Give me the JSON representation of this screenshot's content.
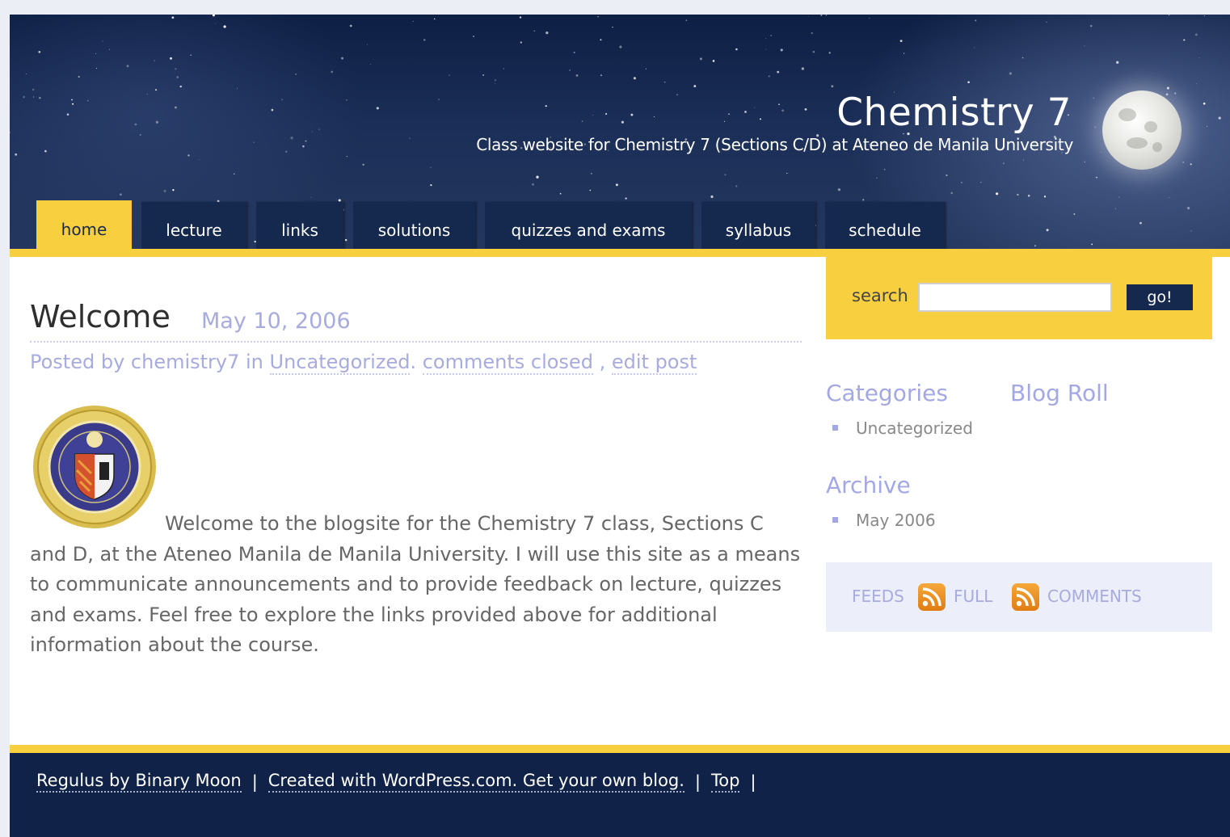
{
  "header": {
    "site_title": "Chemistry 7",
    "tagline": "Class website for Chemistry 7 (Sections C/D) at Ateneo de Manila University"
  },
  "nav": {
    "tabs": [
      {
        "label": "home",
        "active": true
      },
      {
        "label": "lecture"
      },
      {
        "label": "links"
      },
      {
        "label": "solutions"
      },
      {
        "label": "quizzes and exams"
      },
      {
        "label": "syllabus"
      },
      {
        "label": "schedule"
      }
    ]
  },
  "post": {
    "title": "Welcome",
    "date": "May 10, 2006",
    "meta_prefix": "Posted by chemistry7 in",
    "category": "Uncategorized",
    "comments": "comments closed",
    "meta_sep": ",",
    "edit": "edit post",
    "body": "Welcome to the blogsite for the Chemistry 7 class, Sections C and D, at the Ateneo Manila de Manila University. I will use this site as a means to communicate announcements and to provide feedback on lecture, quizzes and exams. Feel free to explore the links provided above for additional information about the course."
  },
  "sidebar": {
    "search_label": "search",
    "search_value": "",
    "search_button": "go!",
    "categories_title": "Categories",
    "categories": [
      "Uncategorized"
    ],
    "blogroll_title": "Blog Roll",
    "archive_title": "Archive",
    "archive": [
      "May 2006"
    ],
    "feeds_label": "FEEDS",
    "feed_full": "FULL",
    "feed_comments": "COMMENTS"
  },
  "footer": {
    "theme_link": "Regulus by Binary Moon",
    "wp_link": "Created with WordPress.com. Get your own blog.",
    "top_link": "Top",
    "separator": "|"
  },
  "colors": {
    "header_navy": "#15294f",
    "accent_yellow": "#f7cf3f",
    "link_lavender": "#a7abdd",
    "footer_navy": "#102247"
  }
}
